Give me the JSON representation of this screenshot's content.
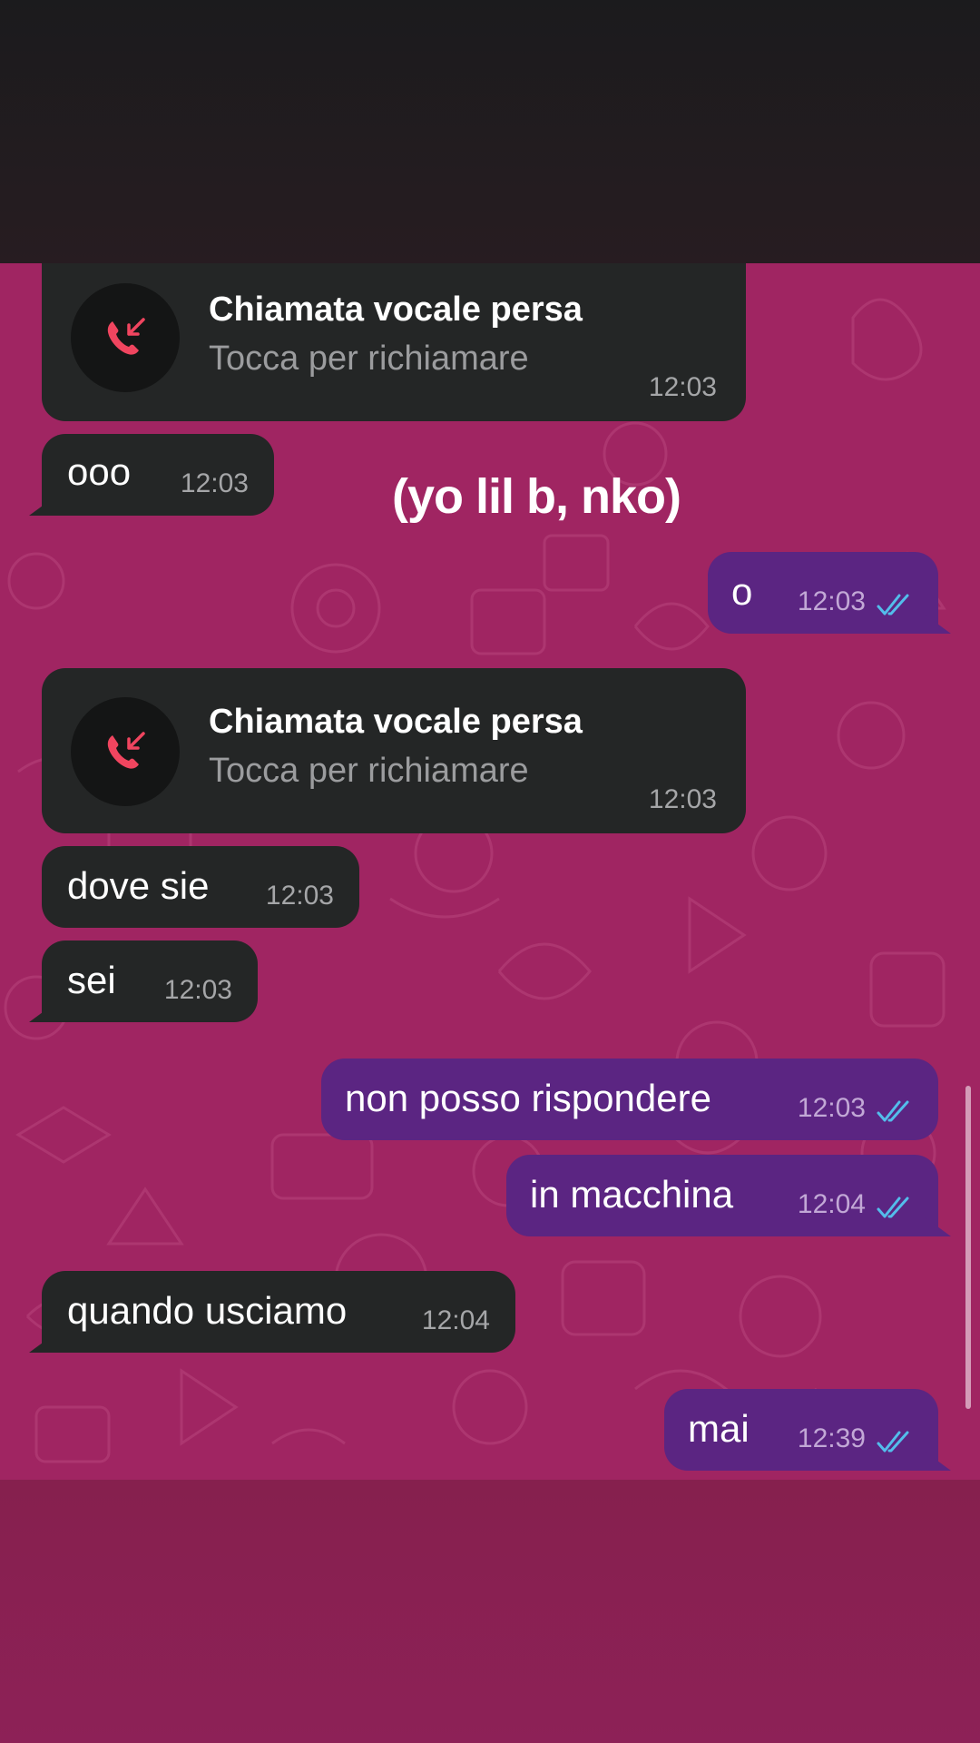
{
  "overlay_caption": "(yo lil b, nko)",
  "messages": [
    {
      "type": "call",
      "title": "Chiamata vocale persa",
      "subtitle": "Tocca per richiamare",
      "time": "12:03",
      "icon": "missed-call-icon"
    },
    {
      "type": "incoming",
      "text": "ooo",
      "time": "12:03"
    },
    {
      "type": "outgoing",
      "text": "o",
      "time": "12:03",
      "status": "read"
    },
    {
      "type": "call",
      "title": "Chiamata vocale persa",
      "subtitle": "Tocca per richiamare",
      "time": "12:03",
      "icon": "missed-call-icon"
    },
    {
      "type": "incoming",
      "text": "dove sie",
      "time": "12:03"
    },
    {
      "type": "incoming",
      "text": "sei",
      "time": "12:03"
    },
    {
      "type": "outgoing",
      "text": "non posso rispondere",
      "time": "12:03",
      "status": "read"
    },
    {
      "type": "outgoing",
      "text": "in macchina",
      "time": "12:04",
      "status": "read"
    },
    {
      "type": "incoming",
      "text": "quando usciamo",
      "time": "12:04"
    },
    {
      "type": "outgoing",
      "text": "mai",
      "time": "12:39",
      "status": "read"
    }
  ],
  "colors": {
    "chat_background": "#a02562",
    "incoming_bubble": "#242626",
    "outgoing_bubble": "#5b2582",
    "read_ticks": "#53bdeb",
    "missed_call": "#f0455f"
  }
}
